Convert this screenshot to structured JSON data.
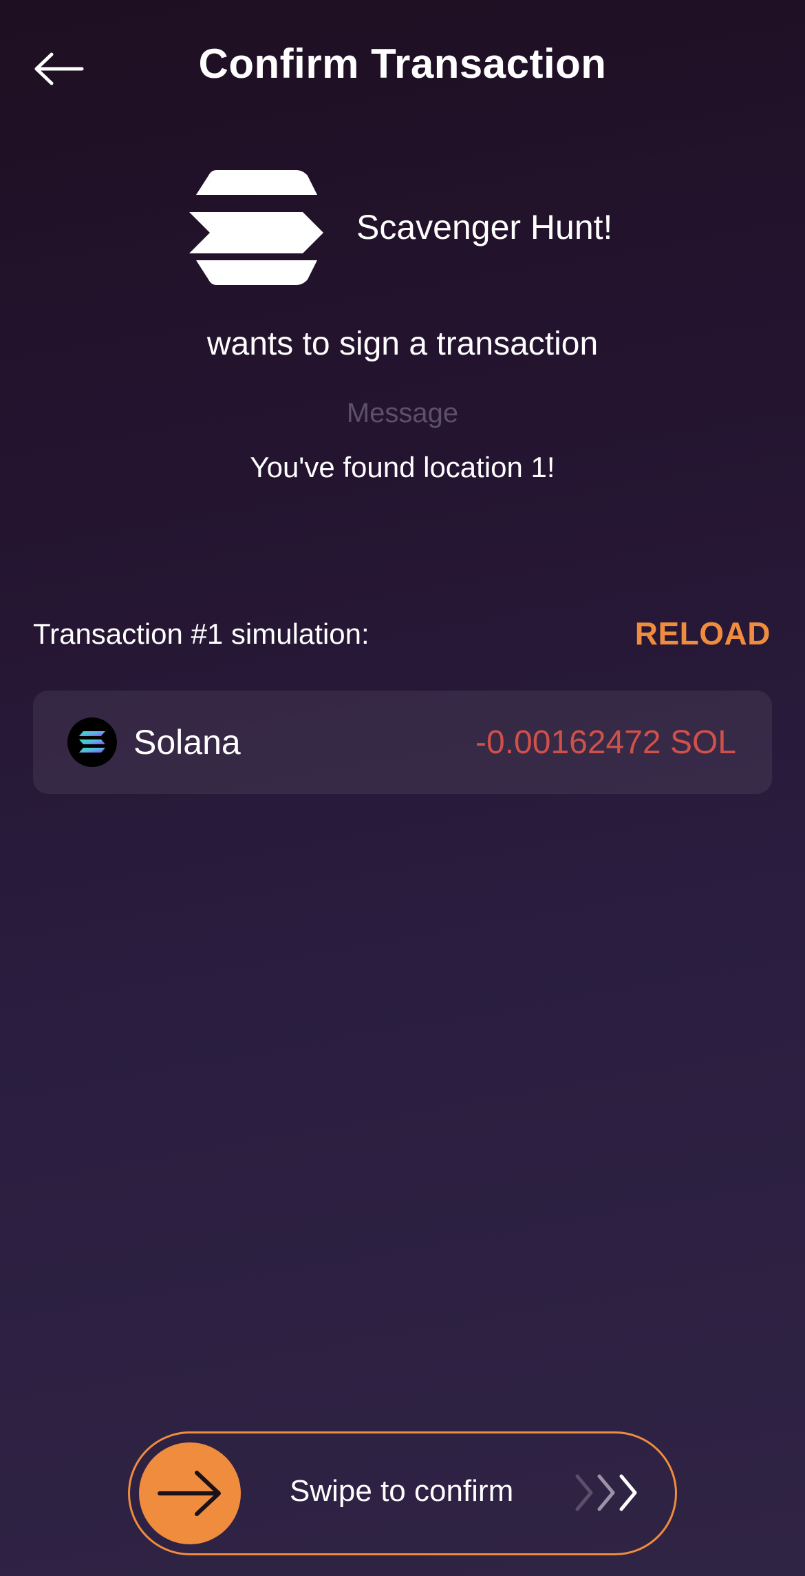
{
  "header": {
    "title": "Confirm Transaction",
    "back_icon": "arrow-left-icon"
  },
  "app": {
    "name": "Scavenger Hunt!",
    "logo_icon": "solana-logo-icon",
    "action": "wants to sign a transaction"
  },
  "message": {
    "label": "Message",
    "text": "You've found location 1!"
  },
  "simulation": {
    "label": "Transaction #1 simulation:",
    "reload_label": "RELOAD",
    "items": [
      {
        "token": "Solana",
        "amount": "-0.00162472 SOL",
        "icon": "solana-token-icon"
      }
    ]
  },
  "swipe": {
    "label": "Swipe to confirm",
    "knob_icon": "arrow-right-icon",
    "hint_icon": "chevrons-right-icon"
  },
  "colors": {
    "accent": "#f08c3e",
    "negative": "#d0504a",
    "muted": "#5e5068"
  }
}
